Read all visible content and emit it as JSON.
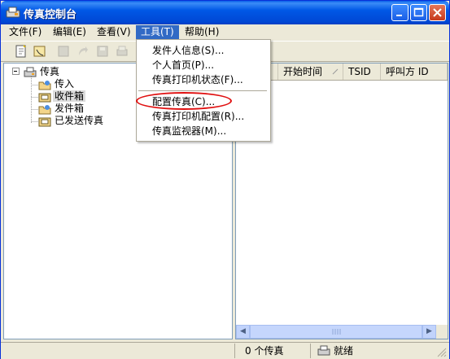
{
  "window": {
    "title": "传真控制台"
  },
  "menubar": {
    "items": [
      {
        "label": "文件(F)"
      },
      {
        "label": "编辑(E)"
      },
      {
        "label": "查看(V)"
      },
      {
        "label": "工具(T)"
      },
      {
        "label": "帮助(H)"
      }
    ]
  },
  "tools_menu": {
    "items": [
      {
        "label": "发件人信息(S)..."
      },
      {
        "label": "个人首页(P)..."
      },
      {
        "label": "传真打印机状态(F)..."
      },
      {
        "label": "配置传真(C)..."
      },
      {
        "label": "传真打印机配置(R)..."
      },
      {
        "label": "传真监视器(M)..."
      }
    ]
  },
  "tree": {
    "root": "传真",
    "children": [
      {
        "label": "传入"
      },
      {
        "label": "收件箱"
      },
      {
        "label": "发件箱"
      },
      {
        "label": "已发送传真"
      }
    ]
  },
  "list": {
    "columns": [
      {
        "label": "开始时间"
      },
      {
        "label": "TSID"
      },
      {
        "label": "呼叫方 ID"
      }
    ]
  },
  "statusbar": {
    "count": "0 个传真",
    "state": "就绪"
  },
  "colors": {
    "title_bar": "#0058e6",
    "menu_highlight": "#316ac5",
    "annotation_ring": "#e01010"
  }
}
